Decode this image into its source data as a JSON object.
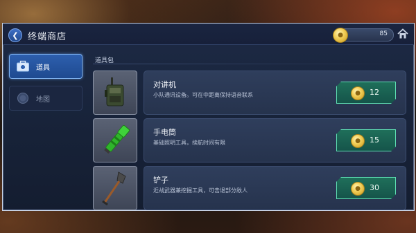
{
  "header": {
    "back_icon": "chevron-left-icon",
    "title": "终端商店",
    "coins": "85",
    "coin_icon": "coin-icon",
    "home_icon": "home-icon"
  },
  "tabs": [
    {
      "label": "道具",
      "icon": "toolbox-icon",
      "active": true
    },
    {
      "label": "地图",
      "icon": "globe-icon",
      "active": false
    }
  ],
  "section": {
    "label": "道具包"
  },
  "items": [
    {
      "name": "对讲机",
      "desc": "小队通讯设备。可在中距离保持语音联系",
      "price": "12",
      "icon": "walkie-talkie-icon"
    },
    {
      "name": "手电筒",
      "desc": "基础照明工具，续航时间有限",
      "price": "15",
      "icon": "flashlight-icon"
    },
    {
      "name": "铲子",
      "desc": "近战武器兼挖掘工具，可击退部分敌人",
      "price": "30",
      "icon": "shovel-icon"
    }
  ],
  "colors": {
    "accent_blue": "#2d5fae",
    "price_green": "#1f6f5a",
    "price_border": "#5fe0b4",
    "coin_gold": "#f3d05a"
  }
}
